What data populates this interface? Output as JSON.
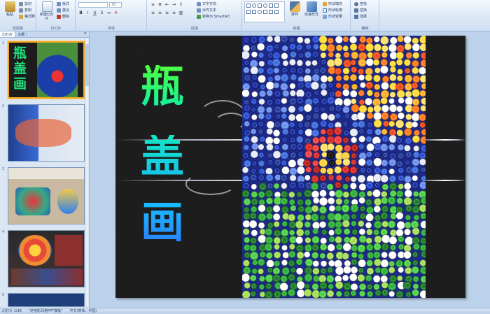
{
  "ribbon": {
    "clipboard": {
      "group_label": "剪贴板",
      "paste_label": "粘贴",
      "cut_label": "剪切",
      "copy_label": "复制",
      "format_painter_label": "格式刷"
    },
    "slides": {
      "group_label": "幻灯片",
      "new_slide_label": "新建幻灯片",
      "layout_label": "版式",
      "reset_label": "重设",
      "delete_label": "删除"
    },
    "font": {
      "group_label": "字体",
      "font_size": "30"
    },
    "paragraph": {
      "group_label": "段落",
      "text_direction_label": "文字方向",
      "align_text_label": "对齐文本",
      "smartart_label": "转换为 SmartArt"
    },
    "drawing": {
      "group_label": "绘图",
      "arrange_label": "排列",
      "quick_styles_label": "快速样式",
      "shape_fill_label": "形状填充",
      "shape_outline_label": "形状轮廓",
      "shape_effects_label": "形状效果"
    },
    "editing": {
      "group_label": "编辑",
      "find_label": "查找",
      "replace_label": "替换",
      "select_label": "选择"
    }
  },
  "panel": {
    "tab_slides": "幻灯片",
    "tab_outline": "大纲",
    "close": "×",
    "thumbs": [
      {
        "num": "1"
      },
      {
        "num": "2"
      },
      {
        "num": "3"
      },
      {
        "num": "4"
      },
      {
        "num": "5"
      }
    ],
    "thumb1_title": "瓶盖画"
  },
  "slide": {
    "title_chars": [
      "瓶",
      "盖",
      "画"
    ],
    "colors": {
      "green": "#19ff4a",
      "teal": "#12e8c8",
      "cyan": "#18c8ff",
      "blue": "#2a8cff"
    }
  },
  "statusbar": {
    "slide_counter": "幻灯片 1/38",
    "theme": "\"老电影风格PPT模板\"",
    "language": "中文(简体，中国)"
  }
}
